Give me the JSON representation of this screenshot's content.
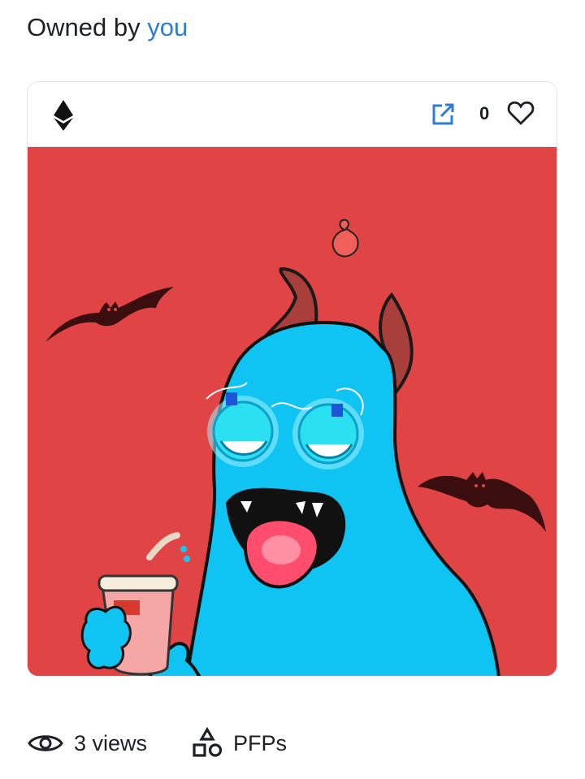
{
  "ownership": {
    "prefix": "Owned by",
    "owner": "you"
  },
  "card": {
    "chain_icon": "ethereum-icon",
    "external_link_icon": "external-link-icon",
    "like_count": "0",
    "like_icon": "heart-icon",
    "image_subject": "blue-monster-with-horns-and-bats"
  },
  "stats": {
    "views": "3 views",
    "views_icon": "eye-icon",
    "category": "PFPs",
    "category_icon": "shapes-icon"
  },
  "colors": {
    "link": "#2d7dd2",
    "art_background": "#e14444",
    "monster_body": "#0fc3f2"
  }
}
